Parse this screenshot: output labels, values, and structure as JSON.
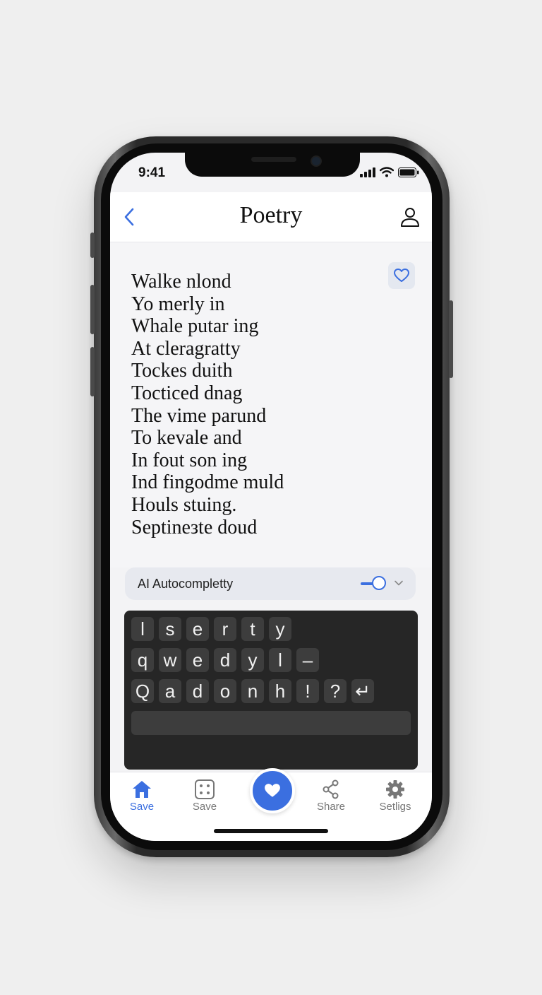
{
  "status_bar": {
    "time": "9:41"
  },
  "header": {
    "title": "Poetry",
    "back_icon": "chevron-left-icon",
    "profile_icon": "person-icon"
  },
  "poem": {
    "lines": [
      "Walke nlond",
      "Yo merly in",
      "Whale putar ing",
      "At cleragratty",
      "Tockes duith",
      "Tocticed dnag",
      "The vime parund",
      "To kevale and",
      "In fout son ing",
      "Ind fingodme muld",
      "Houls stuing.",
      "Septineзte doud"
    ]
  },
  "ai_autocomplete": {
    "label": "AI Autocompletty",
    "enabled": true
  },
  "keyboard": {
    "row1": [
      "l",
      "s",
      "e",
      "r",
      "t",
      "y"
    ],
    "row2": [
      "q",
      "w",
      "e",
      "d",
      "y",
      "l",
      "–"
    ],
    "row3": [
      "Q",
      "a",
      "d",
      "o",
      "n",
      "h",
      "!",
      "?",
      "↵"
    ]
  },
  "tab_bar": {
    "items": [
      {
        "label": "Save",
        "icon": "home-icon",
        "active": true
      },
      {
        "label": "Save",
        "icon": "dice-icon",
        "active": false
      },
      {
        "label": "Share",
        "icon": "share-icon",
        "active": false
      },
      {
        "label": "Setligs",
        "icon": "gear-icon",
        "active": false
      }
    ],
    "center_icon": "heart-icon"
  },
  "colors": {
    "accent": "#3b6fe0",
    "keyboard_bg": "#262626",
    "key_bg": "#3d3d3d"
  }
}
